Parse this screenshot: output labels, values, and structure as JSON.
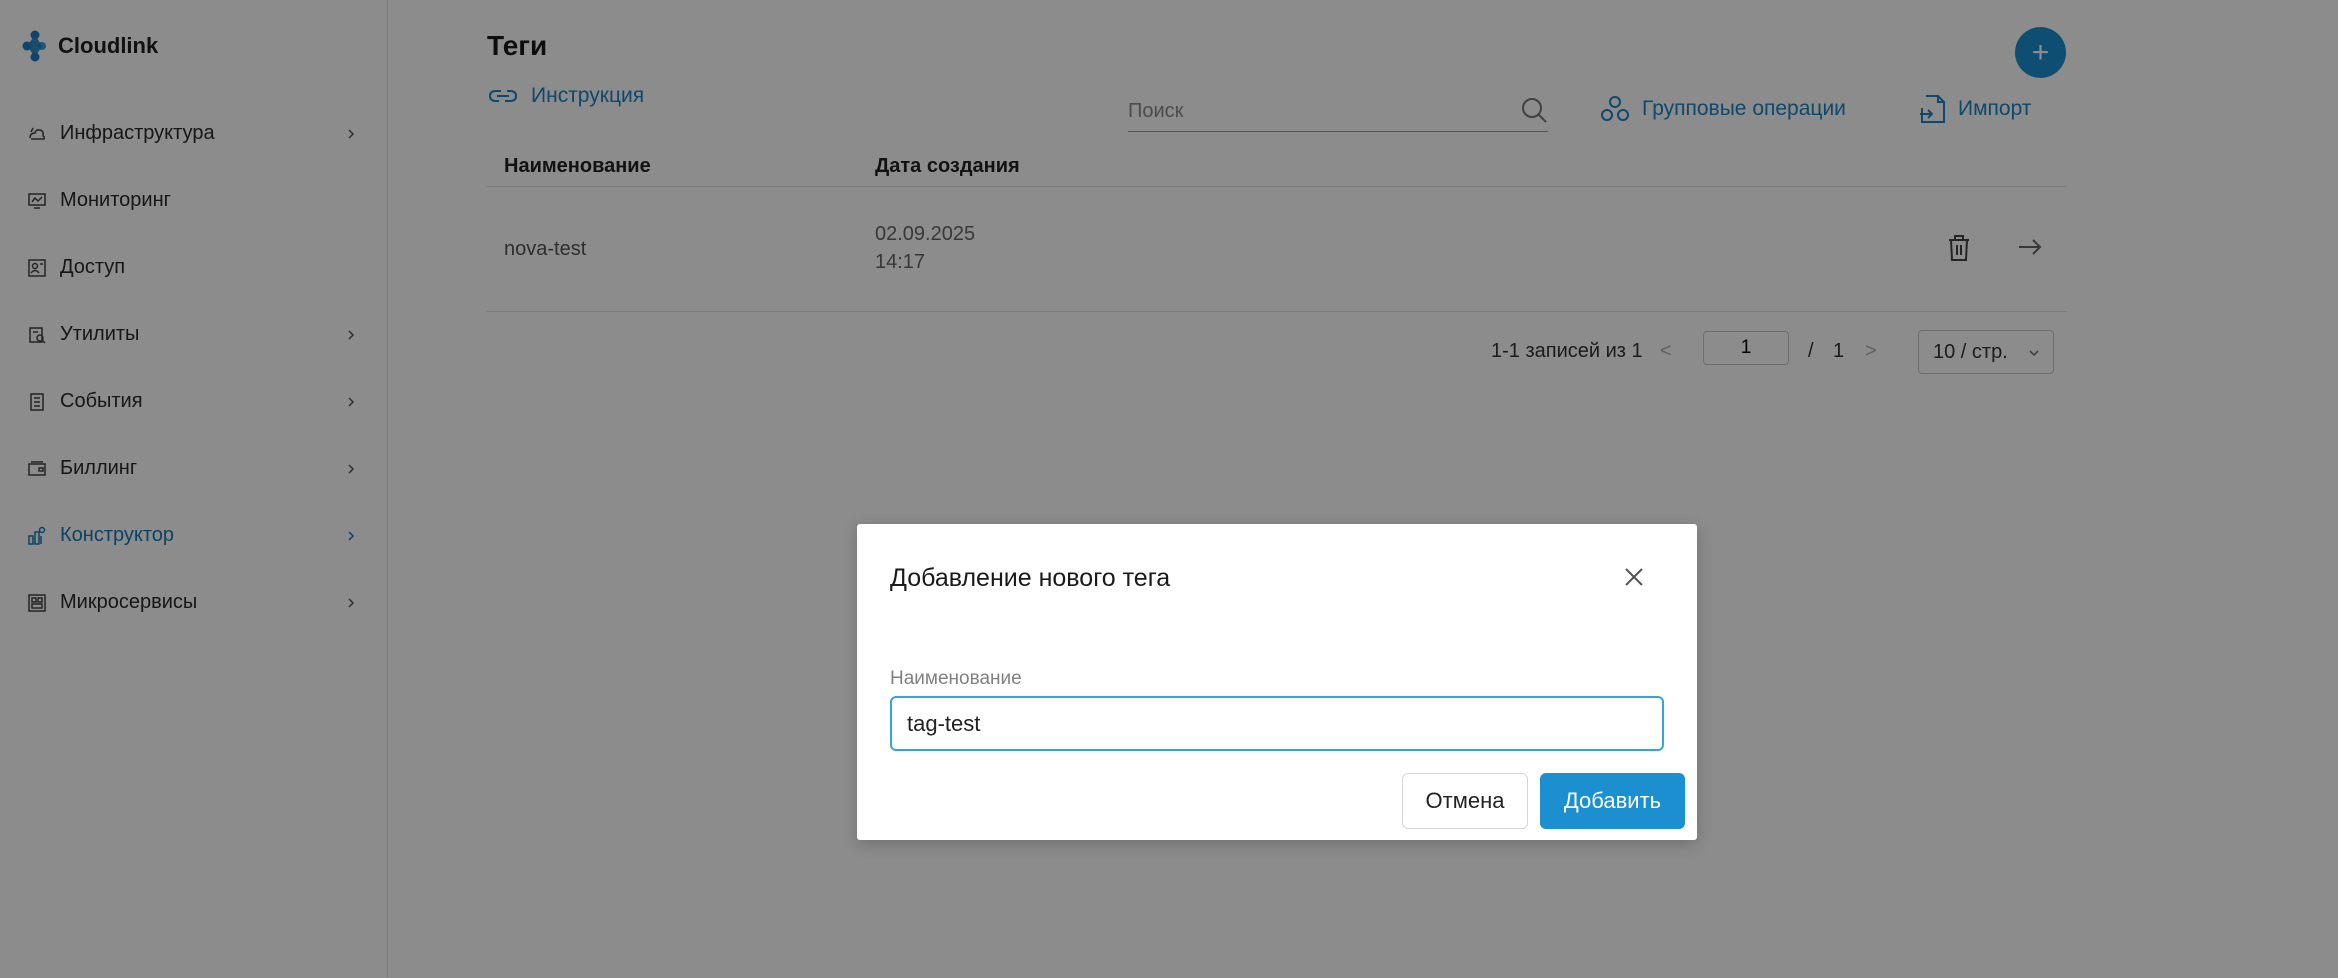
{
  "app": {
    "name": "Cloudlink",
    "accent": "#1b8fd0"
  },
  "sidebar": {
    "items": [
      {
        "label": "Инфраструктура",
        "icon": "infrastructure-icon",
        "has_submenu": true,
        "active": false
      },
      {
        "label": "Мониторинг",
        "icon": "monitor-icon",
        "has_submenu": false,
        "active": false
      },
      {
        "label": "Доступ",
        "icon": "access-icon",
        "has_submenu": false,
        "active": false
      },
      {
        "label": "Утилиты",
        "icon": "utilities-icon",
        "has_submenu": true,
        "active": false
      },
      {
        "label": "События",
        "icon": "events-icon",
        "has_submenu": true,
        "active": false
      },
      {
        "label": "Биллинг",
        "icon": "billing-icon",
        "has_submenu": true,
        "active": false
      },
      {
        "label": "Конструктор",
        "icon": "constructor-icon",
        "has_submenu": true,
        "active": true
      },
      {
        "label": "Микросервисы",
        "icon": "microservices-icon",
        "has_submenu": true,
        "active": false
      }
    ]
  },
  "main": {
    "title": "Теги",
    "add_button": "+",
    "instruction_link": "Инструкция",
    "search": {
      "placeholder": "Поиск",
      "value": ""
    },
    "group_ops": "Групповые операции",
    "import": "Импорт",
    "table": {
      "columns": [
        "Наименование",
        "Дата создания"
      ],
      "rows": [
        {
          "name": "nova-test",
          "date": "02.09.2025",
          "time": "14:17"
        }
      ]
    },
    "pagination": {
      "info": "1-1 записей из 1",
      "prev": "<",
      "current_page": "1",
      "separator": "/",
      "total_pages": "1",
      "next": ">",
      "per_page": "10 / стр."
    }
  },
  "modal": {
    "title": "Добавление нового тега",
    "field_label": "Наименование",
    "field_value": "tag-test",
    "cancel_label": "Отмена",
    "add_label": "Добавить"
  }
}
